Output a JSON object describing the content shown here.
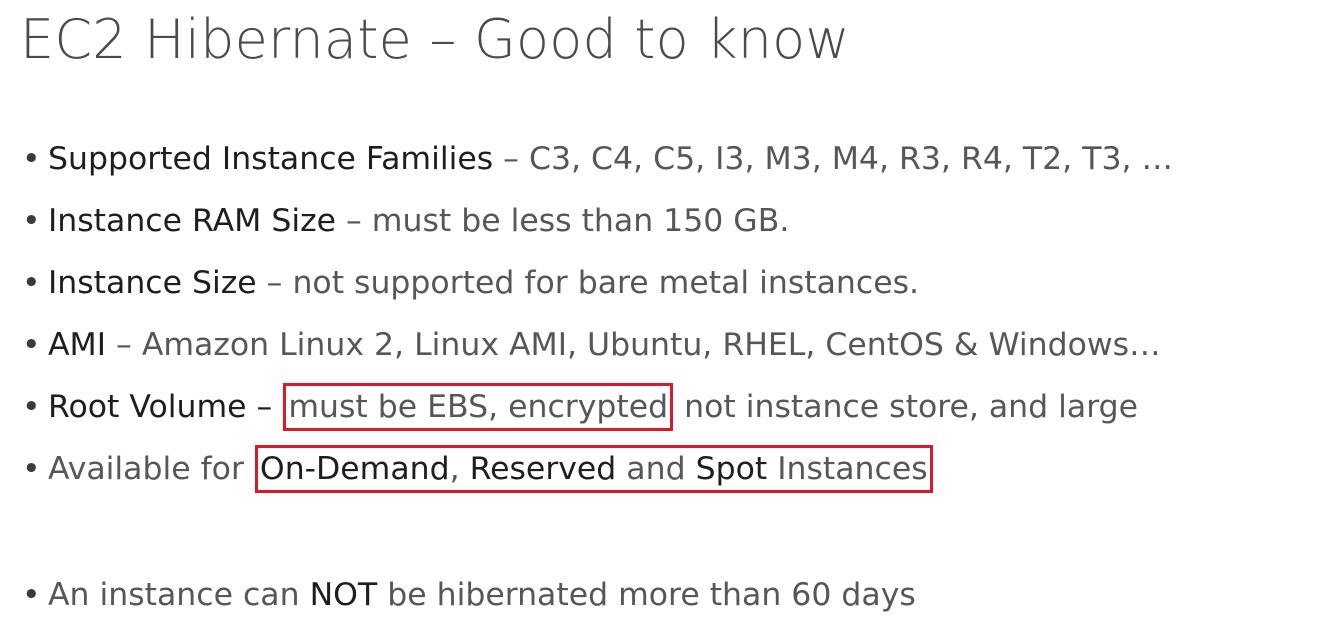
{
  "title": "EC2 Hibernate – Good to know",
  "bullets": [
    {
      "term": "Supported Instance Families",
      "sep": " – ",
      "desc": "C3, C4, C5, I3, M3, M4, R3, R4, T2, T3, …"
    },
    {
      "term": "Instance RAM Size",
      "sep": " – ",
      "desc": "must be less than 150 GB."
    },
    {
      "term": "Instance Size",
      "sep": " – ",
      "desc": "not supported for bare metal instances."
    },
    {
      "term": "AMI",
      "sep": " – ",
      "desc": "Amazon Linux 2, Linux AMI, Ubuntu, RHEL, CentOS & Windows…"
    },
    {
      "term": "Root Volume",
      "sep": " – ",
      "highlight": "must be EBS, encrypted",
      "tail": " not instance store, and large"
    },
    {
      "prefix": "Available for ",
      "hl_term1": "On-Demand",
      "hl_sep1": ", ",
      "hl_term2": "Reserved",
      "hl_mid": " and ",
      "hl_term3": "Spot",
      "hl_tail": " Instances"
    },
    {
      "prefix": "An instance can ",
      "emph": "NOT",
      "tail": " be hibernated more than 60 days"
    }
  ],
  "bullet_char": "•",
  "highlight_color": "#d91a2a"
}
